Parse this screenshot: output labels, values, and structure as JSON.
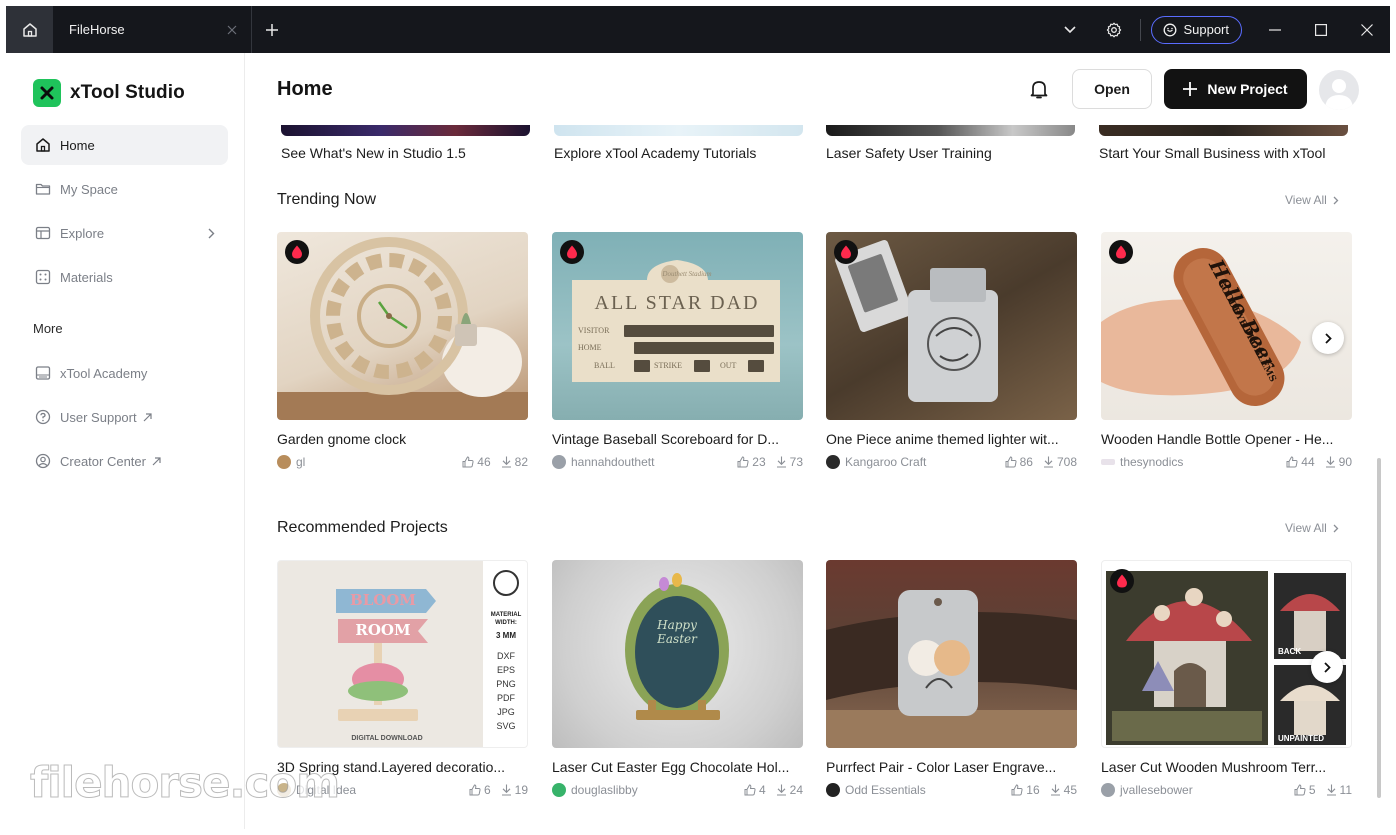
{
  "titlebar": {
    "tab_title": "FileHorse",
    "support_label": "Support"
  },
  "sidebar": {
    "brand": "xTool Studio",
    "items": [
      {
        "label": "Home"
      },
      {
        "label": "My Space"
      },
      {
        "label": "Explore"
      },
      {
        "label": "Materials"
      }
    ],
    "more_label": "More",
    "more_items": [
      {
        "label": "xTool Academy"
      },
      {
        "label": "User Support"
      },
      {
        "label": "Creator Center"
      }
    ]
  },
  "header": {
    "title": "Home",
    "open_label": "Open",
    "new_project_label": "New Project"
  },
  "banners": [
    {
      "title": "See What's New in Studio 1.5"
    },
    {
      "title": "Explore xTool Academy Tutorials"
    },
    {
      "title": "Laser Safety User Training"
    },
    {
      "title": "Start Your Small Business with xTool"
    }
  ],
  "trending": {
    "title": "Trending Now",
    "view_all": "View All",
    "cards": [
      {
        "title": "Garden gnome clock",
        "author": "gl",
        "likes": "46",
        "downloads": "82"
      },
      {
        "title": "Vintage Baseball Scoreboard for D...",
        "author": "hannahdouthett",
        "likes": "23",
        "downloads": "73"
      },
      {
        "title": "One Piece anime themed lighter wit...",
        "author": "Kangaroo Craft",
        "likes": "86",
        "downloads": "708"
      },
      {
        "title": "Wooden Handle Bottle Opener - He...",
        "author": "thesynodics",
        "likes": "44",
        "downloads": "90"
      }
    ]
  },
  "recommended": {
    "title": "Recommended Projects",
    "view_all": "View All",
    "cards": [
      {
        "title": "3D Spring stand.Layered decoratio...",
        "author": "Digital Idea",
        "likes": "6",
        "downloads": "19"
      },
      {
        "title": "Laser Cut Easter Egg Chocolate Hol...",
        "author": "douglaslibby",
        "likes": "4",
        "downloads": "24"
      },
      {
        "title": "Purrfect Pair - Color Laser Engrave...",
        "author": "Odd Essentials",
        "likes": "16",
        "downloads": "45"
      },
      {
        "title": "Laser Cut Wooden Mushroom Terr...",
        "author": "jvallesebower",
        "likes": "5",
        "downloads": "11"
      }
    ]
  },
  "image_text": {
    "scoreboard_header": "Douthett Stadium",
    "scoreboard_title": "ALL STAR DAD",
    "scoreboard_rows": [
      "VISITOR",
      "HOME",
      "BALL",
      "STRIKE",
      "OUT"
    ],
    "opener_text": "Hello Beer",
    "opener_sub": "GOODBYE PROBLEMS",
    "sign_top": "BLOOM",
    "sign_bottom": "ROOM",
    "material_label": "MATERIAL WIDTH:",
    "material_value": "3 MM",
    "formats": [
      "DXF",
      "EPS",
      "PNG",
      "PDF",
      "JPG",
      "SVG"
    ],
    "digital_download": "DIGITAL DOWNLOAD",
    "egg_text": "Happy Easter",
    "mushroom_back": "BACK",
    "mushroom_unpainted": "UNPAINTED"
  },
  "watermark": "filehorse.com",
  "colors": {
    "titlebar_bg": "#15171c",
    "brand_green": "#1fc35b",
    "primary_button": "#121212",
    "support_border": "#5a6cff",
    "badge_red": "#ff2a4d"
  }
}
